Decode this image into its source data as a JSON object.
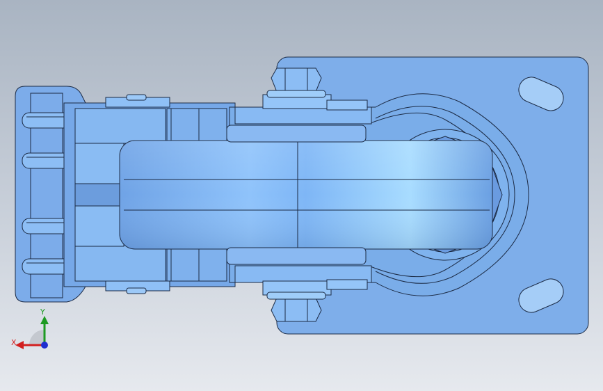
{
  "viewport": {
    "background_top": "#a9b4c2",
    "background_bottom": "#e6e9ee"
  },
  "model": {
    "description_icon": "caster-wheel-assembly-icon",
    "part_fill": "#7fb0ec",
    "part_fill_light": "#a7d3ff",
    "edge_color": "#1b2a44"
  },
  "triad": {
    "x_label": "X",
    "y_label": "Y",
    "x_color": "#d21f1f",
    "y_color": "#1d9a22",
    "z_color": "#1f2fd0"
  }
}
